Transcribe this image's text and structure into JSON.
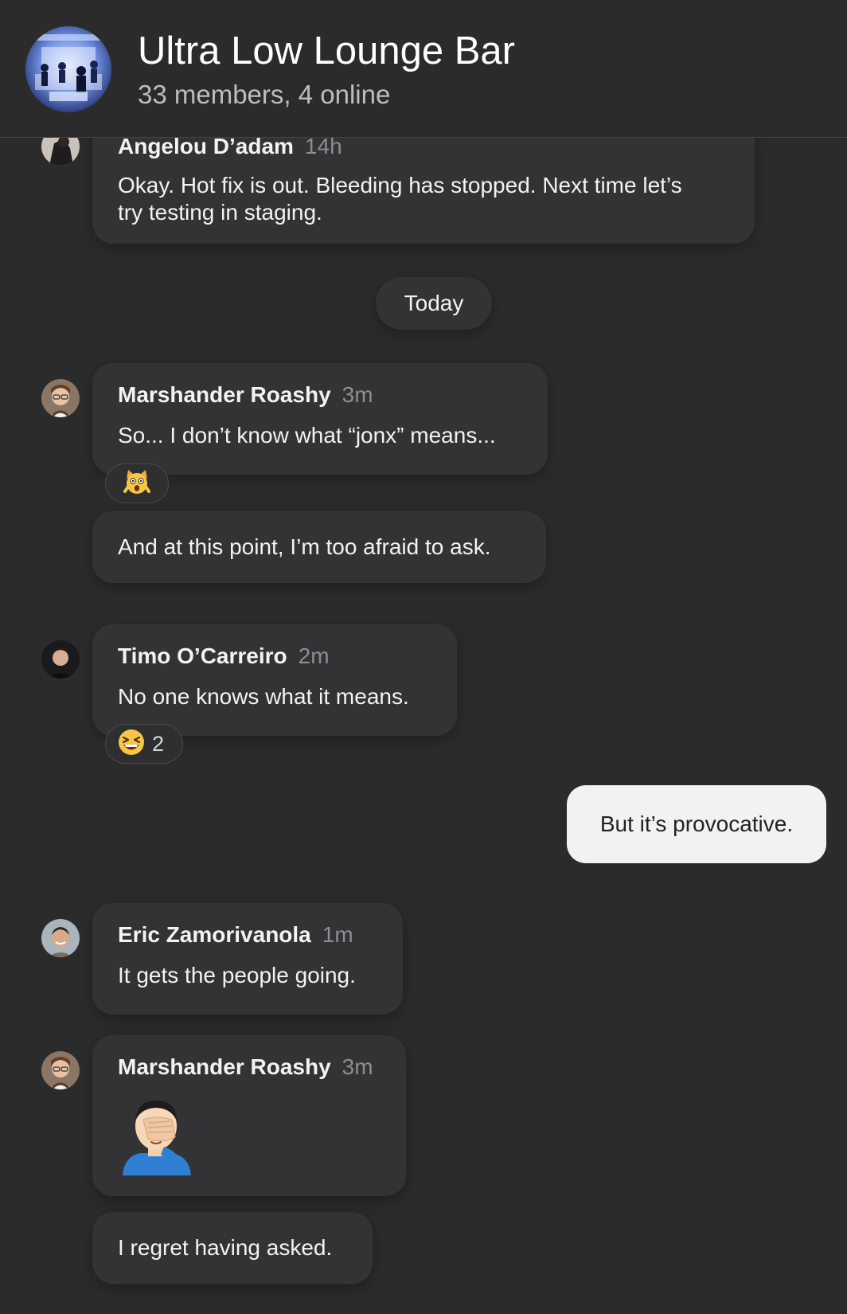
{
  "header": {
    "title": "Ultra Low Lounge Bar",
    "subtitle": "33 members, 4 online",
    "avatar_icon": "group-photo"
  },
  "date_separator": "Today",
  "messages": [
    {
      "sender": "Angelou D’adam",
      "time": "14h",
      "lines": [
        "Okay. Hot fix is out. Bleeding has stopped. Next time let’s",
        "try testing in staging."
      ]
    },
    {
      "sender": "Marshander Roashy",
      "time": "3m",
      "text": "So... I don’t know what “jonx” means...",
      "reaction": {
        "emoji": "🙀",
        "icon": "scream-cat-emoji"
      }
    },
    {
      "text": "And at this point, I’m too afraid to ask."
    },
    {
      "sender": "Timo O’Carreiro",
      "time": "2m",
      "text": "No one knows what it means.",
      "reaction": {
        "emoji": "😆",
        "icon": "laughing-emoji",
        "count": "2"
      }
    },
    {
      "own": true,
      "text": "But it’s provocative."
    },
    {
      "sender": "Eric Zamorivanola",
      "time": "1m",
      "text": "It gets the people going."
    },
    {
      "sender": "Marshander Roashy",
      "time": "3m",
      "sticker": "facepalm-emoji"
    },
    {
      "text": "I regret having asked."
    }
  ],
  "colors": {
    "background": "#2b2b2c",
    "bubble": "#333335",
    "own_bubble": "#f2f2f3",
    "muted": "#8e8e92"
  }
}
